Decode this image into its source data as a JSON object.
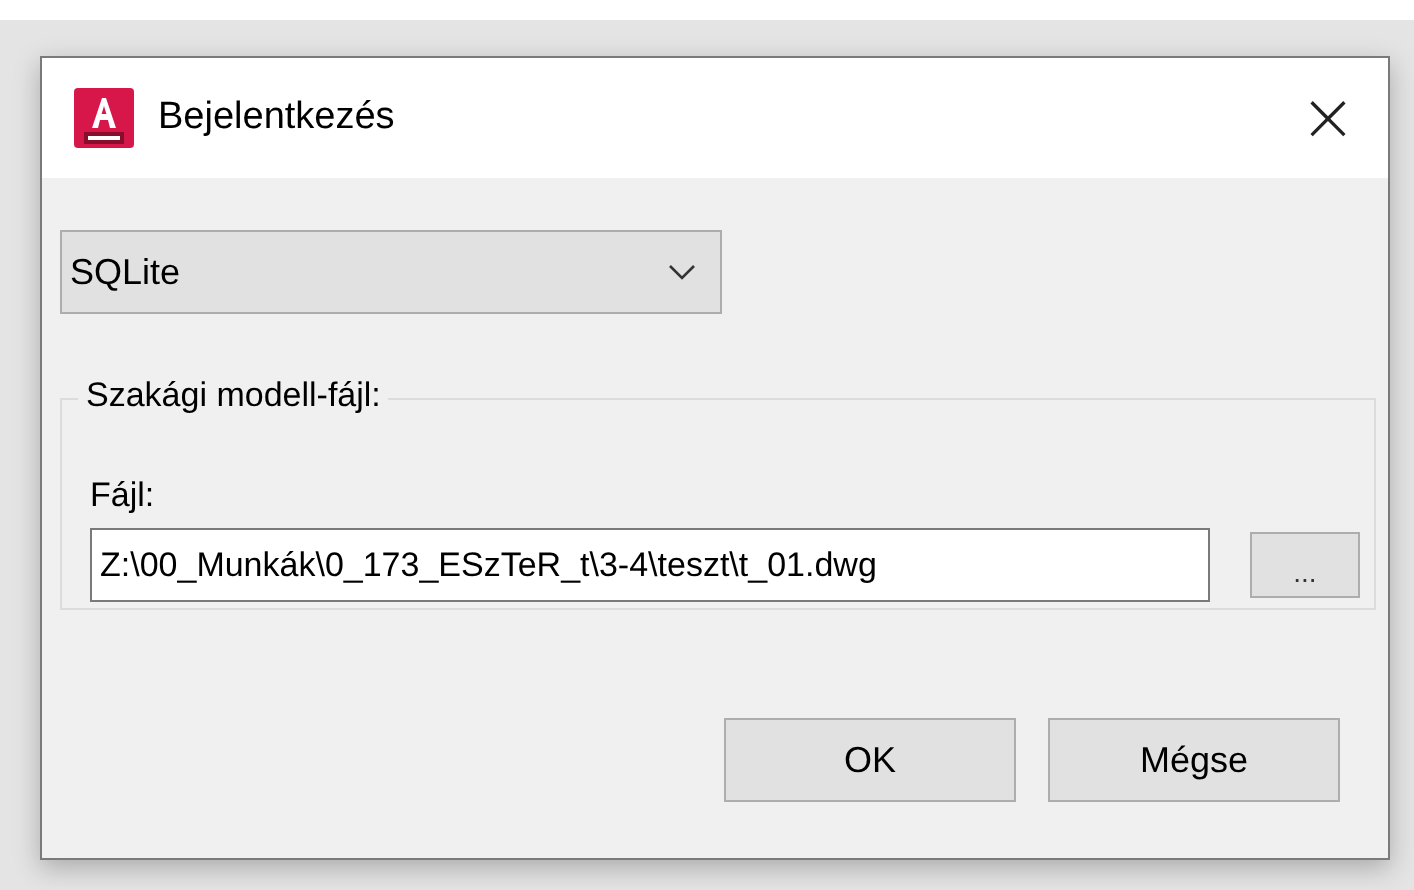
{
  "window": {
    "title": "Bejelentkezés",
    "close": "×"
  },
  "database_type": {
    "value": "SQLite"
  },
  "group": {
    "label": "Szakági modell-fájl:",
    "file_label": "Fájl:",
    "file_value": "Z:\\00_Munkák\\0_173_ESzTeR_t\\3-4\\teszt\\t_01.dwg",
    "browse": "..."
  },
  "buttons": [
    "OK",
    "Mégse"
  ]
}
